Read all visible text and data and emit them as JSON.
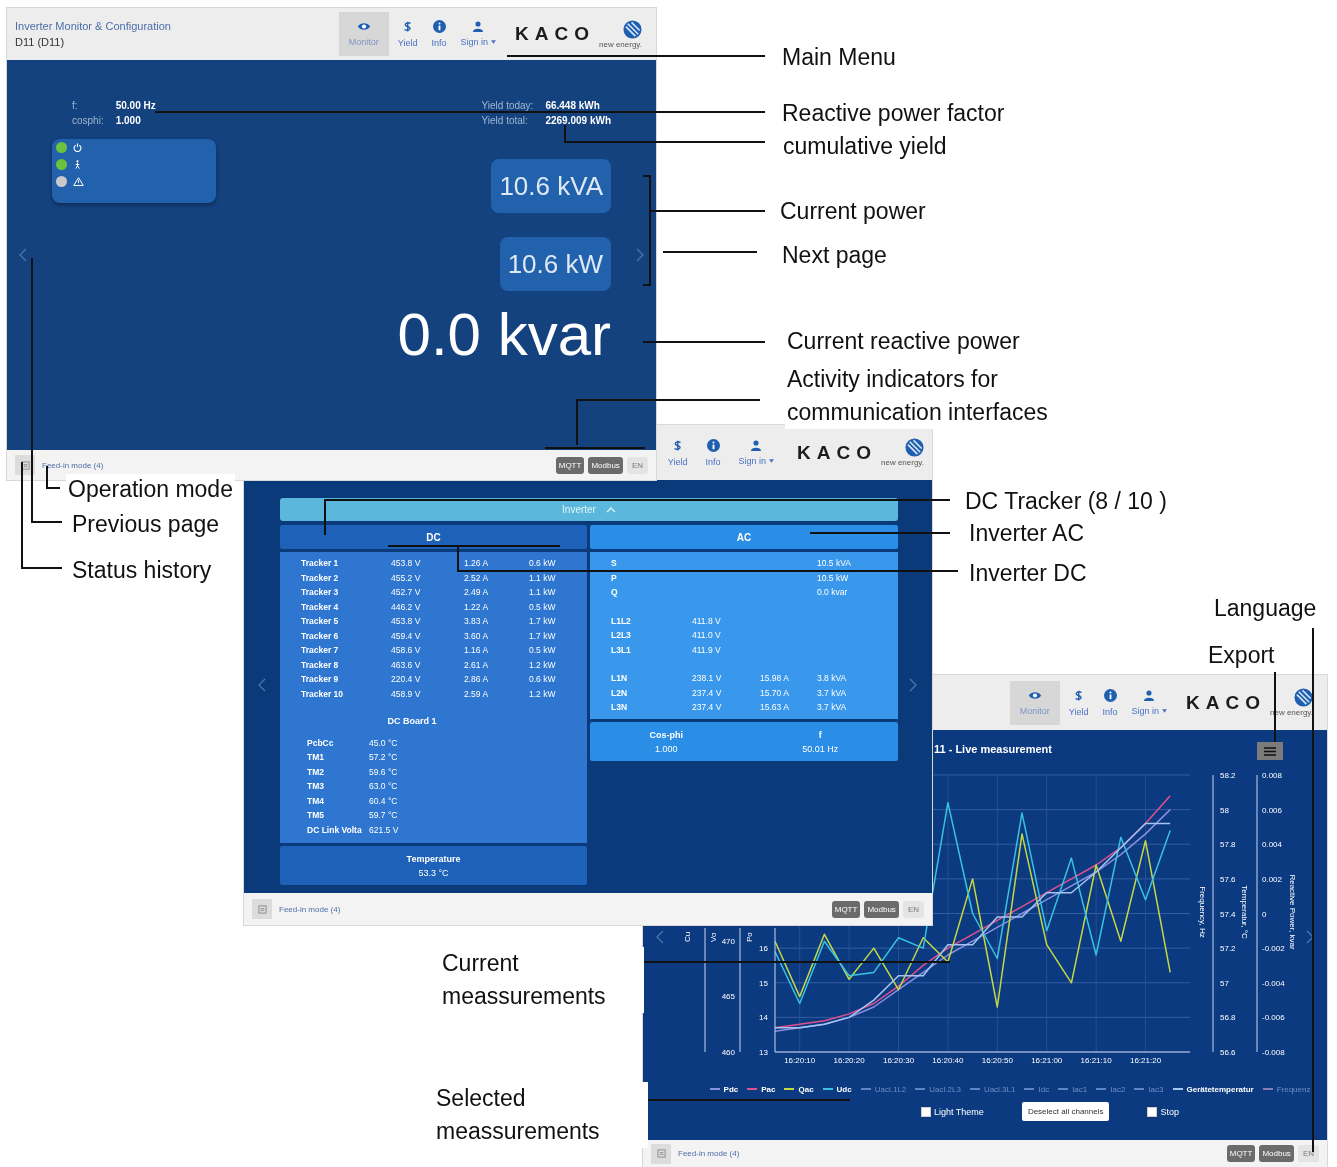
{
  "monitor_screen": {
    "header": {
      "title": "Inverter Monitor & Configuration",
      "subtitle": "D11 (D11)",
      "nav": [
        {
          "kind": "monitor",
          "label": "Monitor",
          "selected": true,
          "dropdown": false
        },
        {
          "kind": "yield",
          "label": "Yield",
          "selected": false,
          "dropdown": false
        },
        {
          "kind": "info",
          "label": "Info",
          "selected": false,
          "dropdown": false
        },
        {
          "kind": "account",
          "label": "Sign in",
          "selected": false,
          "dropdown": true
        }
      ],
      "logo": "KACO",
      "logo_tagline": "new energy."
    },
    "readings_left": [
      {
        "label": "f:",
        "value": "50.00 Hz"
      },
      {
        "label": "cosphi:",
        "value": "1.000"
      }
    ],
    "readings_right": [
      {
        "label": "Yield today:",
        "value": "66.448 kWh"
      },
      {
        "label": "Yield total:",
        "value": "2269.009 kWh"
      }
    ],
    "status_leds": [
      {
        "kind": "power",
        "color": "#6cc13e"
      },
      {
        "kind": "operation",
        "color": "#6cc13e"
      },
      {
        "kind": "warning",
        "color": "#c9c9c9"
      }
    ],
    "apparent_power": "10.6 kVA",
    "active_power": "10.6 kW",
    "reactive_power": "0.0 kvar",
    "footer": {
      "status": "Feed-in mode (4)",
      "indicators": [
        {
          "label": "MQTT",
          "active": true
        },
        {
          "label": "Modbus",
          "active": true
        }
      ],
      "language": "EN"
    }
  },
  "inverter_screen": {
    "header": {
      "nav": [
        {
          "kind": "yield",
          "label": "Yield",
          "selected": false,
          "dropdown": false
        },
        {
          "kind": "info",
          "label": "Info",
          "selected": false,
          "dropdown": false
        },
        {
          "kind": "account",
          "label": "Sign in",
          "selected": false,
          "dropdown": true
        }
      ],
      "logo": "KACO",
      "logo_tagline": "new energy."
    },
    "section": {
      "title": "Inverter",
      "expanded": true
    },
    "dc": {
      "title": "DC",
      "trackers": [
        {
          "name": "Tracker 1",
          "voltage": "453.8 V",
          "current": "1.26 A",
          "power": "0.6 kW"
        },
        {
          "name": "Tracker 2",
          "voltage": "455.2 V",
          "current": "2.52 A",
          "power": "1.1 kW"
        },
        {
          "name": "Tracker 3",
          "voltage": "452.7 V",
          "current": "2.49 A",
          "power": "1.1 kW"
        },
        {
          "name": "Tracker 4",
          "voltage": "446.2 V",
          "current": "1.22 A",
          "power": "0.5 kW"
        },
        {
          "name": "Tracker 5",
          "voltage": "453.8 V",
          "current": "3.83 A",
          "power": "1.7 kW"
        },
        {
          "name": "Tracker 6",
          "voltage": "459.4 V",
          "current": "3.60 A",
          "power": "1.7 kW"
        },
        {
          "name": "Tracker 7",
          "voltage": "458.6 V",
          "current": "1.16 A",
          "power": "0.5 kW"
        },
        {
          "name": "Tracker 8",
          "voltage": "463.6 V",
          "current": "2.61 A",
          "power": "1.2 kW"
        },
        {
          "name": "Tracker 9",
          "voltage": "220.4 V",
          "current": "2.86 A",
          "power": "0.6 kW"
        },
        {
          "name": "Tracker 10",
          "voltage": "458.9 V",
          "current": "2.59 A",
          "power": "1.2 kW"
        }
      ],
      "board_title": "DC Board 1",
      "board_rows": [
        {
          "name": "PcbCc",
          "value": "45.0 °C"
        },
        {
          "name": "TM1",
          "value": "57.2 °C"
        },
        {
          "name": "TM2",
          "value": "59.6 °C"
        },
        {
          "name": "TM3",
          "value": "63.0 °C"
        },
        {
          "name": "TM4",
          "value": "60.4 °C"
        },
        {
          "name": "TM5",
          "value": "59.7 °C"
        },
        {
          "name": "DC Link Volta",
          "value": "621.5 V"
        }
      ],
      "summary": [
        {
          "label": "Temperature",
          "value": "53.3 °C"
        }
      ]
    },
    "ac": {
      "title": "AC",
      "groups": [
        [
          {
            "name": "S",
            "power": "10.5 kVA"
          },
          {
            "name": "P",
            "power": "10.5 kW"
          },
          {
            "name": "Q",
            "power": "0.0 kvar"
          }
        ],
        [
          {
            "name": "L1L2",
            "voltage": "411.8 V"
          },
          {
            "name": "L2L3",
            "voltage": "411.0 V"
          },
          {
            "name": "L3L1",
            "voltage": "411.9 V"
          }
        ],
        [
          {
            "name": "L1N",
            "voltage": "238.1 V",
            "current": "15.98 A",
            "power": "3.8 kVA"
          },
          {
            "name": "L2N",
            "voltage": "237.4 V",
            "current": "15.70 A",
            "power": "3.7 kVA"
          },
          {
            "name": "L3N",
            "voltage": "237.4 V",
            "current": "15.63 A",
            "power": "3.7 kVA"
          }
        ]
      ],
      "summary": [
        {
          "label": "Cos-phi",
          "value": "1.000"
        },
        {
          "label": "f",
          "value": "50.01 Hz"
        }
      ]
    },
    "footer": {
      "status": "Feed-in mode (4)",
      "indicators": [
        {
          "label": "MQTT",
          "active": true
        },
        {
          "label": "Modbus",
          "active": true
        }
      ],
      "language": "EN"
    }
  },
  "live_screen": {
    "header": {
      "nav": [
        {
          "kind": "monitor",
          "label": "Monitor",
          "selected": true,
          "dropdown": false
        },
        {
          "kind": "yield",
          "label": "Yield",
          "selected": false,
          "dropdown": false
        },
        {
          "kind": "info",
          "label": "Info",
          "selected": false,
          "dropdown": false
        },
        {
          "kind": "account",
          "label": "Sign in",
          "selected": false,
          "dropdown": true
        }
      ],
      "logo": "KACO",
      "logo_tagline": "new energy."
    },
    "title": "11 - Live measurement",
    "chart": {
      "left_axes": [
        {
          "title": "Cu"
        },
        {
          "title": "Vo",
          "ticks": [
            "470",
            "465",
            "460"
          ]
        },
        {
          "title": "Po"
        }
      ],
      "chart_data": {
        "type": "line",
        "grid": true,
        "categories": [
          null,
          "16:20:10",
          null,
          "16:20:20",
          null,
          "16:20:30",
          null,
          "16:20:40",
          null,
          "16:20:50",
          null,
          "16:21:00",
          null,
          "16:21:10",
          null,
          "16:21:20",
          null
        ],
        "ylim": [
          13,
          21
        ],
        "yticks": [
          16,
          15,
          14,
          13
        ],
        "series": [
          {
            "name": "Pdc",
            "color": "#8a8fe0",
            "values": [
              13.6,
              13.7,
              13.8,
              14.0,
              14.3,
              14.8,
              15.3,
              15.8,
              16.2,
              16.6,
              17.0,
              17.4,
              17.8,
              18.2,
              18.7,
              19.3,
              20.0
            ]
          },
          {
            "name": "Pac",
            "color": "#e2508e",
            "values": [
              13.7,
              13.8,
              13.9,
              14.1,
              14.4,
              14.9,
              15.5,
              16.0,
              16.4,
              16.8,
              17.2,
              17.6,
              18.0,
              18.4,
              18.9,
              19.6,
              20.4
            ]
          },
          {
            "name": "Qac",
            "color": "#c5d844",
            "values": [
              16.2,
              14.6,
              16.4,
              15.1,
              16.0,
              14.8,
              16.3,
              15.6,
              18.0,
              14.3,
              19.3,
              16.1,
              15.0,
              18.4,
              16.2,
              19.1,
              15.3
            ]
          },
          {
            "name": "Udc",
            "color": "#38c2de",
            "values": [
              15.9,
              14.4,
              16.2,
              15.2,
              15.3,
              16.3,
              16.0,
              20.2,
              17.0,
              15.7,
              19.9,
              16.5,
              18.6,
              15.8,
              19.2,
              17.4,
              19.4
            ]
          },
          {
            "name": "Gerätetemperatur",
            "color": "#a6c4f0",
            "values": [
              13.7,
              13.7,
              13.8,
              14.0,
              14.5,
              15.2,
              15.2,
              16.1,
              16.1,
              16.9,
              16.9,
              17.6,
              17.6,
              18.2,
              18.9,
              19.6,
              19.6
            ]
          }
        ]
      },
      "right_axes": [
        {
          "title": "Frequency, Hz"
        },
        {
          "title": "Temperatur, °C",
          "ticks": [
            "58.2",
            "58",
            "57.8",
            "57.6",
            "57.4",
            "57.2",
            "57",
            "56.8",
            "56.6"
          ]
        },
        {
          "title": "Reactive Power, kvar",
          "ticks": [
            "0.008",
            "0.006",
            "0.004",
            "0.002",
            "0",
            "-0.002",
            "-0.004",
            "-0.006",
            "-0.008"
          ]
        }
      ],
      "legend": [
        {
          "kind": "series",
          "selected": true
        },
        {
          "kind": "series",
          "selected": true
        },
        {
          "kind": "series",
          "selected": true
        },
        {
          "kind": "series",
          "selected": true
        },
        {
          "label": "Uacl.1L2",
          "color": "#5f86c4",
          "selected": false
        },
        {
          "label": "Uacl.2L3",
          "color": "#5f86c4",
          "selected": false
        },
        {
          "label": "Uacl.3L1",
          "color": "#5f86c4",
          "selected": false
        },
        {
          "label": "Idc",
          "color": "#5f86c4",
          "selected": false
        },
        {
          "label": "Iac1",
          "color": "#5f86c4",
          "selected": false
        },
        {
          "label": "Iac2",
          "color": "#5f86c4",
          "selected": false
        },
        {
          "label": "Iac3",
          "color": "#5f86c4",
          "selected": false
        },
        {
          "kind": "series",
          "selected": true
        },
        {
          "label": "Frequenz",
          "color": "#8a7cb0",
          "selected": false
        }
      ]
    },
    "light_theme": {
      "label": "Light Theme",
      "checked": false
    },
    "deselect_button": "Deselect all channels",
    "stop": {
      "label": "Stop",
      "checked": false
    },
    "footer": {
      "status": "Feed-in mode (4)",
      "indicators": [
        {
          "label": "MQTT",
          "active": true
        },
        {
          "label": "Modbus",
          "active": true
        }
      ],
      "language": "EN"
    }
  },
  "annotations": [
    {
      "text": "Main Menu"
    },
    {
      "text": "Reactive power factor"
    },
    {
      "text": "cumulative yield"
    },
    {
      "text": "Current power"
    },
    {
      "text": "Next page"
    },
    {
      "text": "Current reactive power"
    },
    {
      "text": "Activity indicators for communication interfaces"
    },
    {
      "text": "Operation mode"
    },
    {
      "text": "Previous page"
    },
    {
      "text": "Status history"
    },
    {
      "text": "DC Tracker (8 / 10 )"
    },
    {
      "text": "Inverter AC"
    },
    {
      "text": "Inverter DC"
    },
    {
      "text": "Language"
    },
    {
      "text": "Export"
    },
    {
      "text": "Current meassurements"
    },
    {
      "text": "Selected meassurements"
    }
  ]
}
